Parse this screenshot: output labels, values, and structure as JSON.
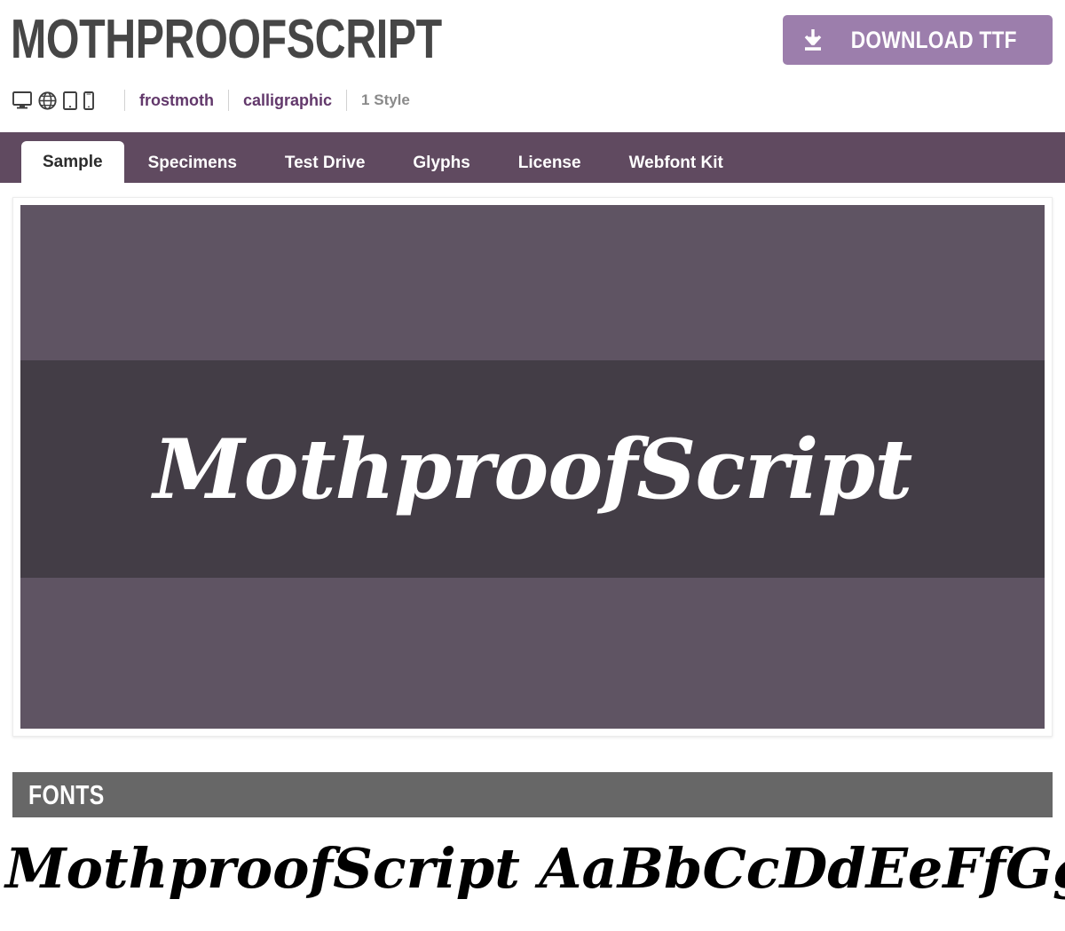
{
  "header": {
    "font_title": "MothproofScript",
    "download_button": {
      "label": "Download TTF",
      "icon": "download-arrow-icon",
      "color": "#9c7eac"
    }
  },
  "meta": {
    "device_icons": [
      "desktop-icon",
      "globe-icon",
      "tablet-icon",
      "mobile-icon"
    ],
    "designer": "frostmoth",
    "category": "calligraphic",
    "style_count": "1 Style",
    "link_color": "#62386b",
    "plain_color": "#8a8a8a"
  },
  "tabs": {
    "bar_color": "#604a60",
    "items": [
      {
        "label": "Sample",
        "active": true
      },
      {
        "label": "Specimens",
        "active": false
      },
      {
        "label": "Test Drive",
        "active": false
      },
      {
        "label": "Glyphs",
        "active": false
      },
      {
        "label": "License",
        "active": false
      },
      {
        "label": "Webfont Kit",
        "active": false
      }
    ]
  },
  "sample": {
    "preview_text": "MothproofScript",
    "background_light": "#5f5463",
    "background_dark": "#433d46",
    "text_color": "#ffffff"
  },
  "fonts_section": {
    "heading": "Fonts",
    "heading_bar_color": "#676767",
    "specimen_text": "MothproofScript AaBbCcDdEeFfGgHhIi",
    "specimen_color": "#000000"
  }
}
